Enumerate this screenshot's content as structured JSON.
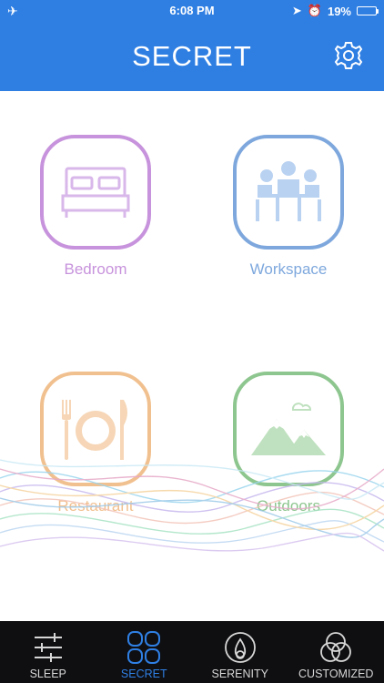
{
  "status": {
    "time": "6:08 PM",
    "battery": "19%",
    "battery_level": 0.19
  },
  "header": {
    "title": "SECRET",
    "settings_icon": "gear-icon",
    "color": "#2f7fe3"
  },
  "tiles": [
    {
      "label": "Bedroom",
      "icon": "bed-icon",
      "color": "#c793dc"
    },
    {
      "label": "Workspace",
      "icon": "meeting-table-icon",
      "color": "#7ea8dd"
    },
    {
      "label": "Restaurant",
      "icon": "plate-cutlery-icon",
      "color": "#f1c08f"
    },
    {
      "label": "Outdoors",
      "icon": "mountains-icon",
      "color": "#8ec68f"
    }
  ],
  "tabbar": {
    "active_color": "#2f7fe3",
    "tabs": [
      {
        "label": "SLEEP",
        "icon": "sliders-icon"
      },
      {
        "label": "SECRET",
        "icon": "grid-icon"
      },
      {
        "label": "SERENITY",
        "icon": "circle-drop-icon"
      },
      {
        "label": "CUSTOMIZED",
        "icon": "venn-icon"
      }
    ]
  }
}
